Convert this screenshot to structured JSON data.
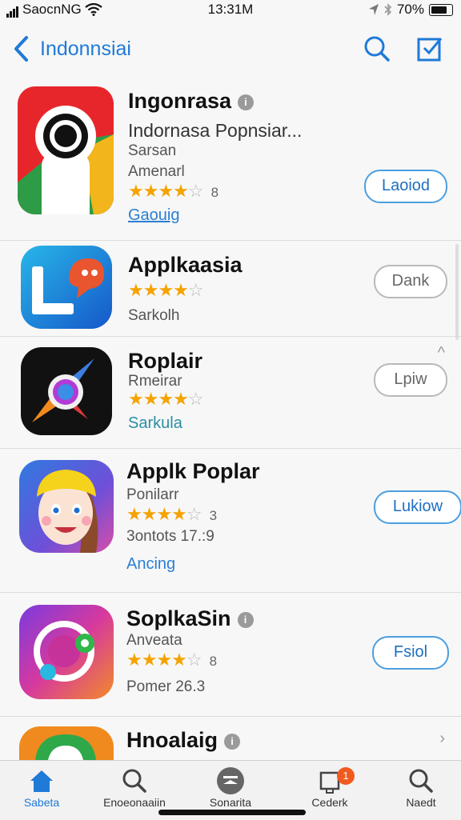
{
  "status_bar": {
    "carrier": "SaocnNG",
    "time": "13:31M",
    "battery": "70%"
  },
  "nav": {
    "back_label": "Indonnsiai"
  },
  "apps": [
    {
      "name": "Ingonrasa",
      "subtitle": "Indornasa Popnsiar...",
      "line1": "Sarsan",
      "line2": "Amenarl",
      "rating_count": "8",
      "link": "Gaouig",
      "button": "Laoiod"
    },
    {
      "name": "Applkaasia",
      "line1": "Sarkolh",
      "button": "Dank"
    },
    {
      "name": "Roplair",
      "line1": "Rmeirar",
      "line2": "Sarkula",
      "button": "Lpiw"
    },
    {
      "name": "Applk Poplar",
      "line1": "Ponilarr",
      "rating_count": "3",
      "line2": "3ontots 17.:9",
      "link": "Ancing",
      "button": "Lukiow"
    },
    {
      "name": "SoplkaSin",
      "line1": "Anveata",
      "rating_count": "8",
      "line2": "Pomer 26.3",
      "button": "Fsiol"
    },
    {
      "name": "Hnoalaig"
    }
  ],
  "tabs": [
    {
      "label": "Sabeta"
    },
    {
      "label": "Enoeonaaiin"
    },
    {
      "label": "Sonarita"
    },
    {
      "label": "Cederk",
      "badge": "1"
    },
    {
      "label": "Naedt"
    }
  ],
  "colors": {
    "accent": "#1f7ad8",
    "star": "#f5a300"
  }
}
